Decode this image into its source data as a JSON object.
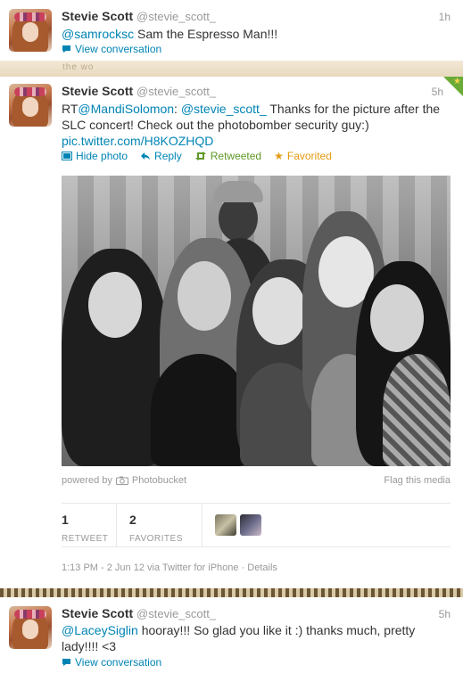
{
  "tweets": [
    {
      "name": "Stevie Scott",
      "handle": "@stevie_scott_",
      "time": "1h",
      "mention": "@samrocksc",
      "text": " Sam the Espresso Man!!!",
      "view_conversation": "View conversation"
    },
    {
      "name": "Stevie Scott",
      "handle": "@stevie_scott_",
      "time": "5h",
      "rt_prefix": "RT",
      "mention1": "@MandiSolomon",
      "colon": ": ",
      "mention2": "@stevie_scott_",
      "text": " Thanks for the picture after the SLC concert! Check out the photobomber security guy:)",
      "link": "pic.twitter.com/H8KOZHQD",
      "actions": {
        "hide_photo": "Hide photo",
        "reply": "Reply",
        "retweeted": "Retweeted",
        "favorited": "Favorited"
      },
      "photo_powered_by": "powered by",
      "photo_service": "Photobucket",
      "flag_media": "Flag this media",
      "stats": {
        "retweets": "1",
        "retweets_label": "RETWEET",
        "favorites": "2",
        "favorites_label": "FAVORITES"
      },
      "timestamp": "1:13 PM - 2 Jun 12 via Twitter for iPhone · Details"
    },
    {
      "name": "Stevie Scott",
      "handle": "@stevie_scott_",
      "time": "5h",
      "mention": "@LaceySiglin",
      "text": " hooray!!! So glad you like it :) thanks much, pretty lady!!!! <3",
      "view_conversation": "View conversation"
    }
  ],
  "background_strip_text": "the wo",
  "colors": {
    "link": "#0084b4",
    "retweeted": "#609928",
    "favorited": "#e49b11",
    "muted": "#999999"
  },
  "icons": [
    "speech-bubble-icon",
    "photo-icon",
    "reply-arrow-icon",
    "retweet-icon",
    "star-icon",
    "camera-icon"
  ]
}
